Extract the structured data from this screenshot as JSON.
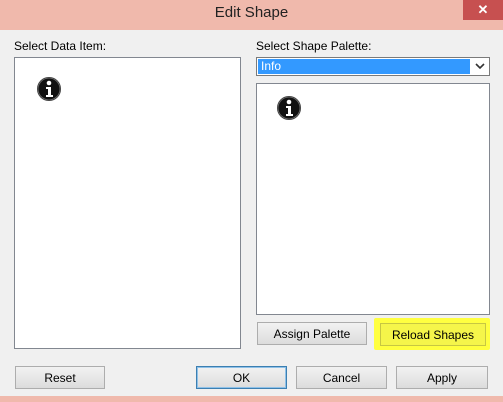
{
  "window": {
    "title": "Edit Shape",
    "close_glyph": "✕"
  },
  "left_panel": {
    "label": "Select Data Item:",
    "item_icon": "info-icon"
  },
  "right_panel": {
    "label": "Select Shape Palette:",
    "palette_selected": "Info",
    "shape_icon": "info-icon"
  },
  "buttons": {
    "assign_palette": "Assign Palette",
    "reload_shapes": "Reload Shapes",
    "reset": "Reset",
    "ok": "OK",
    "cancel": "Cancel",
    "apply": "Apply"
  },
  "colors": {
    "highlight": "#ffff40",
    "selection": "#3399ff",
    "titlebar": "#f0b9ac"
  }
}
